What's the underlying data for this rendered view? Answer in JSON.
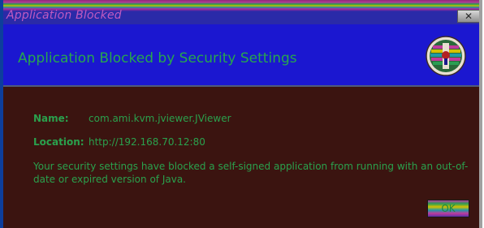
{
  "window": {
    "title": "Application Blocked",
    "close_glyph": "✕"
  },
  "header": {
    "title": "Application Blocked by Security Settings",
    "icon": "java-security-shield-icon"
  },
  "details": {
    "name_label": "Name:",
    "name_value": "com.ami.kvm.jviewer.JViewer",
    "location_label": "Location:",
    "location_value": "http://192.168.70.12:80"
  },
  "message": "Your security settings have blocked a self-signed application from running with an out-of-date or expired version of Java.",
  "buttons": {
    "ok_label": "OK"
  },
  "colors": {
    "header_bg": "#1b17d0",
    "body_bg": "#3b1410",
    "text": "#2aa14d"
  }
}
